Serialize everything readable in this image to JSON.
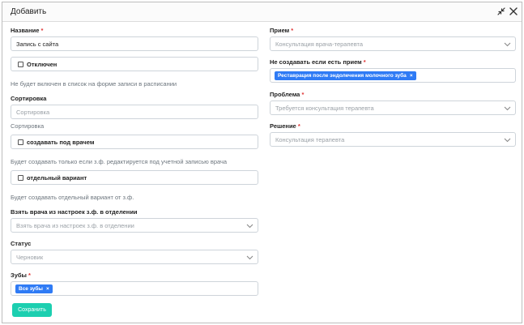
{
  "dialog": {
    "title": "Добавить",
    "minimize_icon": "minimize-arrows-icon",
    "close_icon": "close-x-icon"
  },
  "required_mark": "*",
  "left": {
    "name": {
      "label": "Название",
      "value": "Запись с сайта"
    },
    "disabled": {
      "label": "Отключен",
      "checked": false,
      "hint": "Не будет включен в список на форме записи в расписании"
    },
    "sort": {
      "label": "Сортировка",
      "placeholder": "Сортировка",
      "hint": "Сортировка"
    },
    "create_under_doctor": {
      "label": "создавать под врачем",
      "checked": false,
      "hint": "Будет создавать только если з.ф. редактируется под учетной записью врача"
    },
    "separate_variant": {
      "label": "отдельный вариант",
      "checked": false,
      "hint": "Будет создавать отдельный вариант от з.ф."
    },
    "take_doctor": {
      "label": "Взять врача из настроек з.ф. в отделении",
      "placeholder": "Взять врача из настроек з.ф. в отделении"
    },
    "status": {
      "label": "Статус",
      "value": "Черновик"
    },
    "teeth": {
      "label": "Зубы",
      "tags": [
        "Все зубы"
      ]
    },
    "save_label": "Сохранить"
  },
  "right": {
    "appointment": {
      "label": "Прием",
      "placeholder": "Консультация врача-терапевта"
    },
    "no_create_if": {
      "label": "Не создавать если есть прием",
      "tags": [
        "Реставрация после эндолечения молочного зуба"
      ]
    },
    "problem": {
      "label": "Проблема",
      "placeholder": "Требуется консультация терапевта"
    },
    "solution": {
      "label": "Решение",
      "placeholder": "Консультация терапевта"
    }
  },
  "colors": {
    "accent": "#1ccfb0",
    "tag": "#2f7bf5",
    "required": "#e03131"
  }
}
